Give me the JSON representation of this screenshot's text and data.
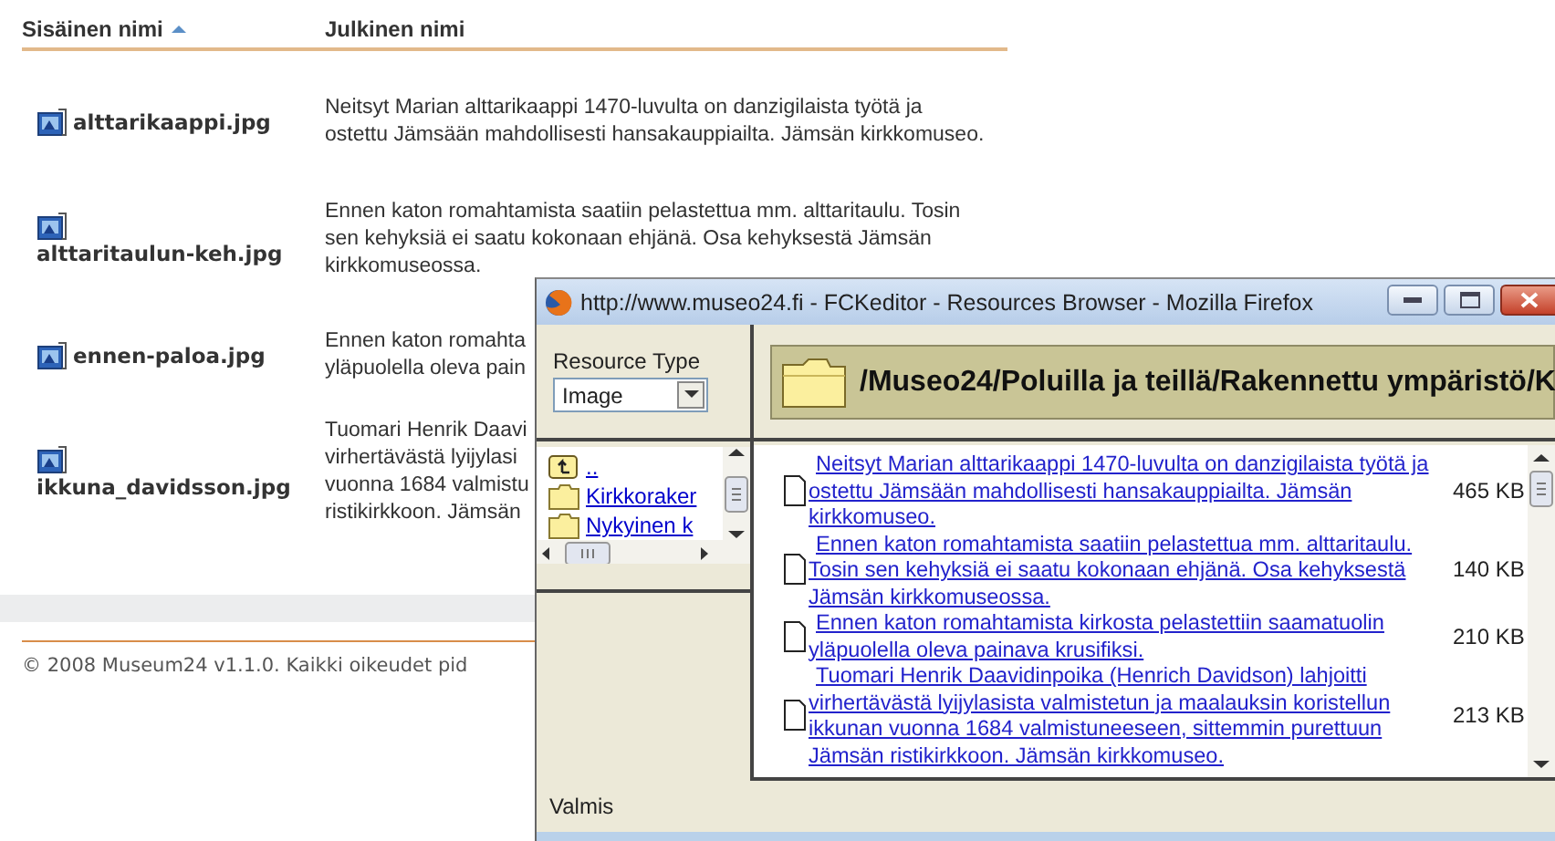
{
  "table": {
    "columns": [
      {
        "label": "Sisäinen nimi",
        "sorted": true
      },
      {
        "label": "Julkinen nimi",
        "sorted": false
      }
    ],
    "rows": [
      {
        "file": "alttarikaappi.jpg",
        "description_lines": [
          "Neitsyt Marian alttarikaappi 1470-luvulta on danzigilaista työtä ja",
          "ostettu Jämsään mahdollisesti hansakauppiailta. Jämsän kirkkomuseo."
        ]
      },
      {
        "file": "alttaritaulun-keh.jpg",
        "description_lines": [
          "Ennen katon romahtamista saatiin pelastettua mm. alttaritaulu. Tosin",
          "sen kehyksiä ei saatu kokonaan ehjänä. Osa kehyksestä Jämsän",
          "kirkkomuseossa."
        ]
      },
      {
        "file": "ennen-paloa.jpg",
        "description_lines": [
          "Ennen katon romahta",
          "yläpuolella oleva pain"
        ]
      },
      {
        "file": "ikkuna_davidsson.jpg",
        "description_lines": [
          "Tuomari Henrik Daavi",
          "virhertävästä lyijylasi",
          "vuonna 1684 valmistu",
          "ristikirkkoon. Jämsän"
        ]
      }
    ]
  },
  "footer": "© 2008 Museum24 v1.1.0. Kaikki oikeudet pid",
  "popup": {
    "title": "http://www.museo24.fi - FCKeditor - Resources Browser - Mozilla Firefox",
    "resource_type_label": "Resource Type",
    "resource_type": "Image",
    "path": "/Museo24/Poluilla ja teillä/Rakennettu ympäristö/K",
    "folders": [
      {
        "name": "..",
        "kind": "up"
      },
      {
        "name": "Kirkkoraker",
        "kind": "folder"
      },
      {
        "name": "Nykyinen k",
        "kind": "folder"
      }
    ],
    "files": [
      {
        "description": "Neitsyt Marian alttarikaappi 1470-luvulta on danzigilaista työtä ja ostettu Jämsään mahdollisesti hansakauppiailta. Jämsän kirkkomuseo.",
        "size": "465 KB"
      },
      {
        "description": "Ennen katon romahtamista saatiin pelastettua mm. alttaritaulu. Tosin sen kehyksiä ei saatu kokonaan ehjänä. Osa kehyksestä Jämsän kirkkomuseossa.",
        "size": "140 KB"
      },
      {
        "description": "Ennen katon romahtamista kirkosta pelastettiin saamatuolin yläpuolella oleva painava krusifiksi.",
        "size": "210 KB"
      },
      {
        "description": "Tuomari Henrik Daavidinpoika (Henrich Davidson) lahjoitti virhertävästä lyijylasista valmistetun ja maalauksin koristellun ikkunan vuonna 1684 valmistuneeseen, sittemmin purettuun Jämsän ristikirkkoon. Jämsän kirkkomuseo.",
        "size": "213 KB"
      }
    ],
    "status": "Valmis"
  }
}
